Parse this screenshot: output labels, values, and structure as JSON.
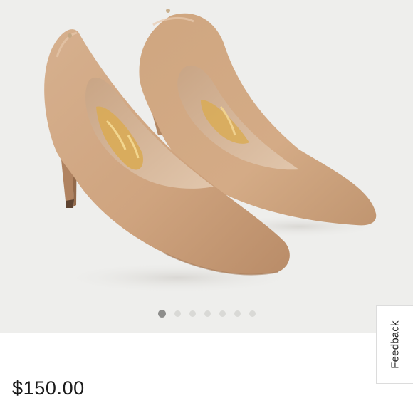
{
  "product": {
    "image_alt": "Nude pointed-toe leather pumps with stiletto heels",
    "price": "$150.00"
  },
  "gallery": {
    "total_images": 7,
    "active_index": 0
  },
  "feedback": {
    "label": "Feedback"
  },
  "colors": {
    "gallery_bg": "#eeeeec",
    "dot_active": "#8d8d8b",
    "dot_inactive": "#d9d9d6",
    "leather": "#d3a883",
    "lining_gold": "#d9ab56"
  }
}
